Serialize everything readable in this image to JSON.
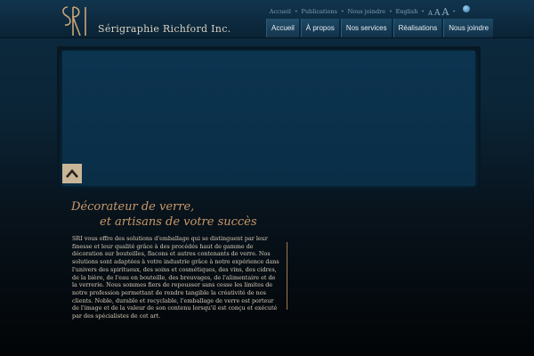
{
  "brand": {
    "logo_text": "SRI",
    "name": "Sérigraphie Richford Inc."
  },
  "utility_nav": {
    "items": [
      "Accueil",
      "Publications",
      "Nous joindre",
      "English"
    ],
    "font_sizes": [
      "A",
      "A",
      "A"
    ]
  },
  "main_nav": {
    "tabs": [
      "Accueil",
      "À propos",
      "Nos services",
      "Réalisations",
      "Nous joindre"
    ],
    "active_index": 0
  },
  "hero": {
    "collapse_icon": "chevron-up-icon"
  },
  "content": {
    "tagline_line1": "Décorateur de verre,",
    "tagline_line2": "et artisans de votre succès",
    "body": "SRI vous offre des solutions d'emballage qui se distinguent par leur finesse et leur qualité grâce à des procédés haut de gamme de décoration sur bouteilles, flacons et autres contenants de verre. Nos solutions sont adaptées à votre industrie grâce à notre expérience dans l'univers des spiritueux, des soins et cosmétiques, des vins, des cidres, de la bière, de l'eau en bouteille, des breuvages, de l'alimentaire et de la verrerie. Nous sommes fiers de repousser sans cesse les limites de notre profession permettant de rendre tangible la créativité de nos clients. Noble, durable et recyclable, l'emballage de verre est porteur de l'image et de la valeur de son contenu lorsqu'il est conçu et exécuté par des spécialistes de cet art."
  },
  "colors": {
    "accent_gold": "#c89a6a",
    "nav_bg": "#1d4a66",
    "button_beige": "#c9b699"
  }
}
